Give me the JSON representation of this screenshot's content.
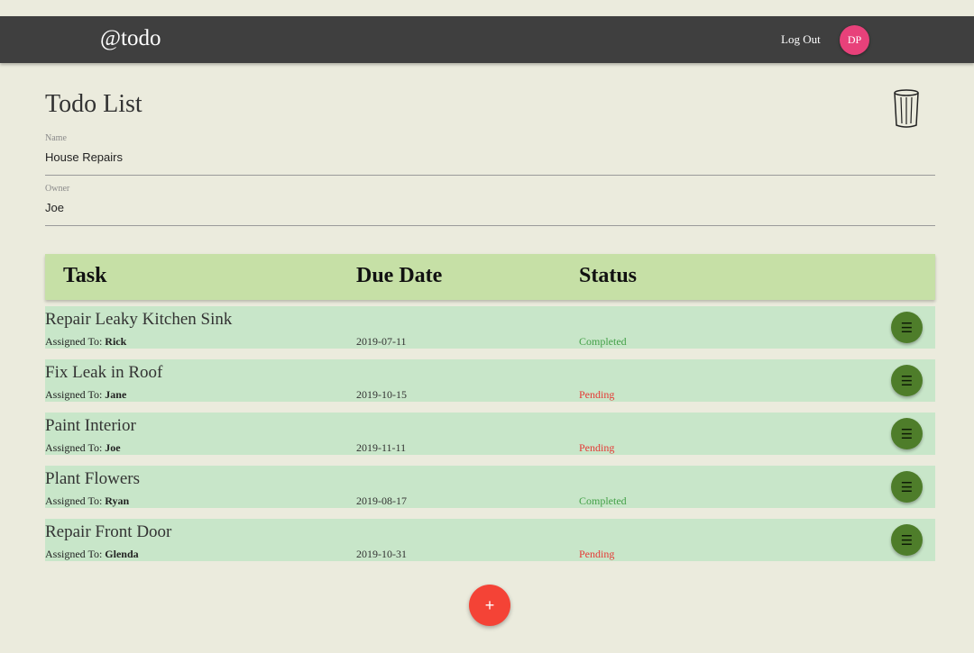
{
  "navbar": {
    "brand": "@todo",
    "logout_label": "Log Out",
    "avatar_initials": "DP",
    "avatar_color": "#e8417a"
  },
  "page": {
    "title": "Todo List",
    "delete_icon": "trash-icon"
  },
  "form": {
    "name_label": "Name",
    "name_value": "House Repairs",
    "owner_label": "Owner",
    "owner_value": "Joe"
  },
  "table": {
    "headers": [
      "Task",
      "Due Date",
      "Status"
    ],
    "assigned_prefix": "Assigned To:",
    "rows": [
      {
        "title": "Repair Leaky Kitchen Sink",
        "assignee": "Rick",
        "due": "2019-07-11",
        "status": "Completed"
      },
      {
        "title": "Fix Leak in Roof",
        "assignee": "Jane",
        "due": "2019-10-15",
        "status": "Pending"
      },
      {
        "title": "Paint Interior",
        "assignee": "Joe",
        "due": "2019-11-11",
        "status": "Pending"
      },
      {
        "title": "Plant Flowers",
        "assignee": "Ryan",
        "due": "2019-08-17",
        "status": "Completed"
      },
      {
        "title": "Repair Front Door",
        "assignee": "Glenda",
        "due": "2019-10-31",
        "status": "Pending"
      }
    ],
    "row_menu_icon": "menu-icon",
    "row_menu_glyph": "☰"
  },
  "fab": {
    "label": "+",
    "color": "#f44336"
  },
  "colors": {
    "navbar": "#3f3f3f",
    "header_bg": "#c6e0a6",
    "row_bg": "#c8e6c9",
    "completed": "#43a047",
    "pending": "#e53935",
    "row_button": "#4e7d2a"
  }
}
